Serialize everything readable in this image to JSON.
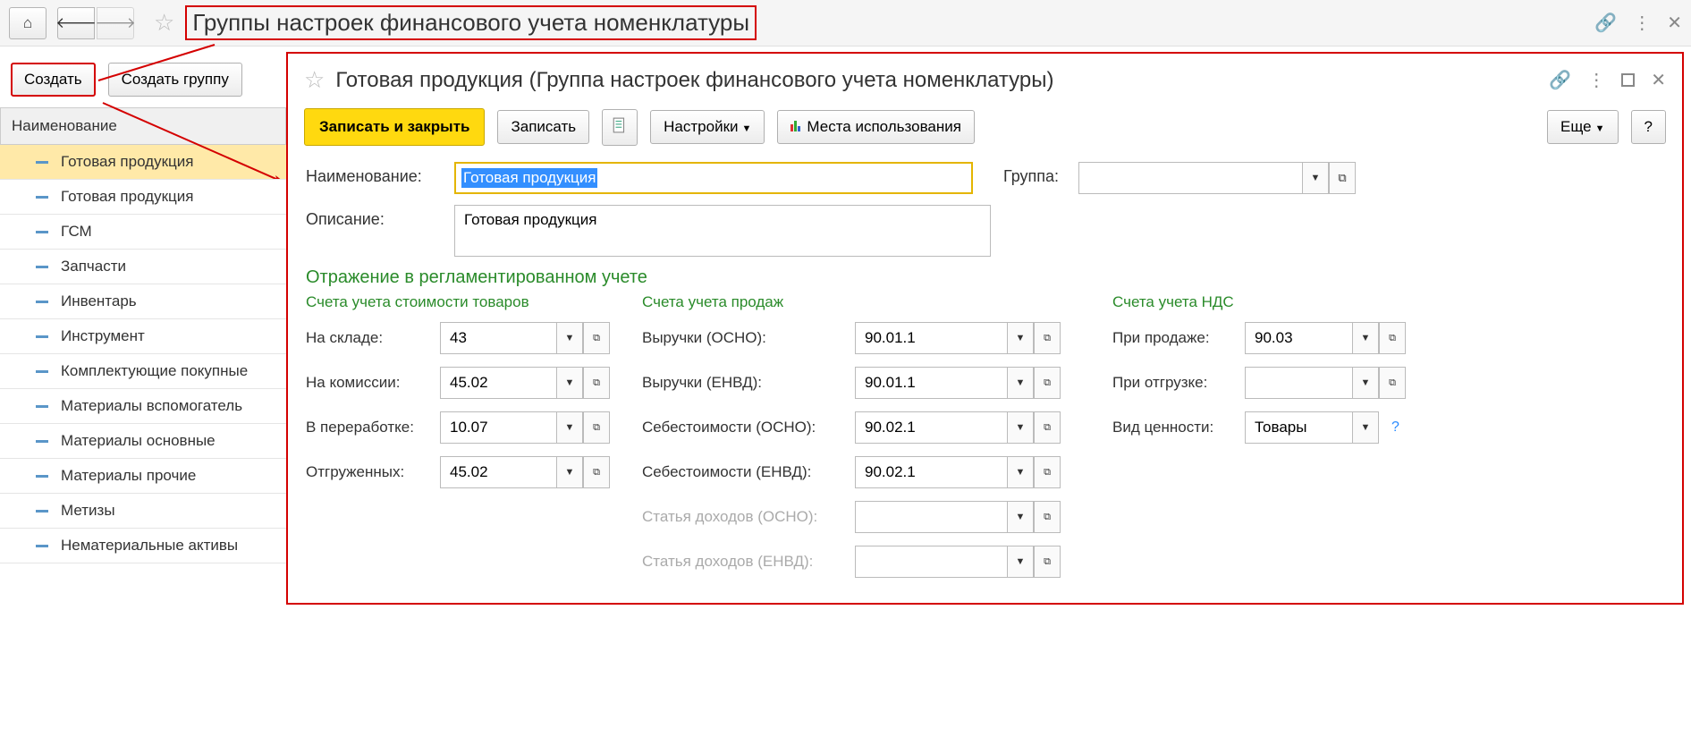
{
  "nav": {
    "home": "⌂",
    "back": "←",
    "forward": "→"
  },
  "page_title": "Группы настроек финансового учета номенклатуры",
  "left": {
    "create": "Создать",
    "create_group": "Создать группу",
    "col_header": "Наименование",
    "items": [
      "Готовая продукция",
      "Готовая продукция",
      "ГСМ",
      "Запчасти",
      "Инвентарь",
      "Инструмент",
      "Комплектующие покупные",
      "Материалы вспомогатель",
      "Материалы основные",
      "Материалы прочие",
      "Метизы",
      "Нематериальные активы"
    ]
  },
  "right": {
    "title": "Готовая продукция (Группа настроек финансового учета номенклатуры)",
    "cmd": {
      "save_close": "Записать и закрыть",
      "save": "Записать",
      "settings": "Настройки",
      "usage": "Места использования",
      "more": "Еще",
      "help": "?"
    },
    "fields": {
      "name_label": "Наименование:",
      "name_value": "Готовая продукция",
      "group_label": "Группа:",
      "group_value": "",
      "desc_label": "Описание:",
      "desc_value": "Готовая продукция"
    },
    "section": "Отражение в регламентированном учете",
    "col1": {
      "title": "Счета учета стоимости товаров",
      "rows": [
        {
          "label": "На складе:",
          "val": "43"
        },
        {
          "label": "На комиссии:",
          "val": "45.02"
        },
        {
          "label": "В переработке:",
          "val": "10.07"
        },
        {
          "label": "Отгруженных:",
          "val": "45.02"
        }
      ]
    },
    "col2": {
      "title": "Счета учета продаж",
      "rows": [
        {
          "label": "Выручки (ОСНО):",
          "val": "90.01.1"
        },
        {
          "label": "Выручки (ЕНВД):",
          "val": "90.01.1"
        },
        {
          "label": "Себестоимости (ОСНО):",
          "val": "90.02.1"
        },
        {
          "label": "Себестоимости (ЕНВД):",
          "val": "90.02.1"
        },
        {
          "label": "Статья доходов (ОСНО):",
          "val": ""
        },
        {
          "label": "Статья доходов (ЕНВД):",
          "val": ""
        }
      ]
    },
    "col3": {
      "title": "Счета учета НДС",
      "rows": [
        {
          "label": "При продаже:",
          "val": "90.03"
        },
        {
          "label": "При отгрузке:",
          "val": ""
        },
        {
          "label": "Вид ценности:",
          "val": "Товары"
        }
      ]
    }
  }
}
